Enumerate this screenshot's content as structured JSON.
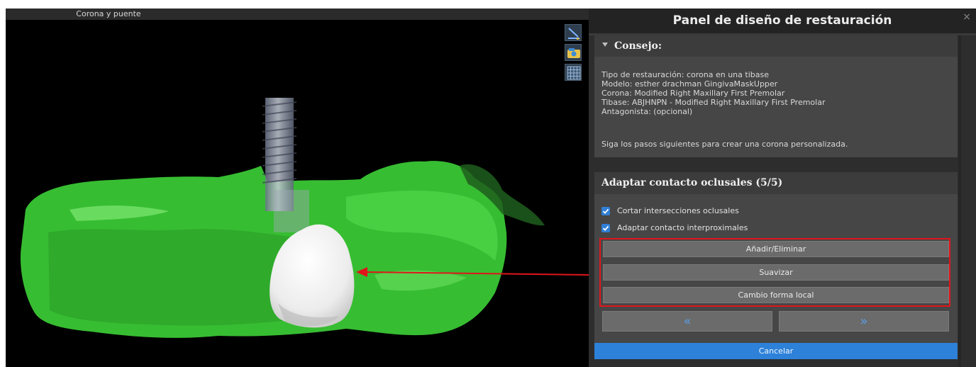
{
  "viewport": {
    "title": "Corona y puente",
    "tools": [
      "clip-plane-icon",
      "camera-icon",
      "grid-icon"
    ]
  },
  "panel": {
    "title": "Panel de diseño de restauración",
    "close_label": "×",
    "advice": {
      "header": "Consejo:",
      "lines": [
        "Tipo de restauración: corona en una tibase",
        "Modelo: esther drachman GingivaMaskUpper",
        "Corona: Modified Right Maxillary First Premolar",
        "Tibase: ABJHNPN - Modified Right Maxillary First Premolar",
        "Antagonista: (opcional)",
        "",
        "Siga los pasos siguientes para crear una corona personalizada."
      ]
    },
    "step": {
      "header": "Adaptar contacto oclusales (5/5)",
      "checkboxes": [
        {
          "label": "Cortar intersecciones oclusales",
          "checked": true
        },
        {
          "label": "Adaptar contacto interproximales",
          "checked": true
        }
      ],
      "buttons": {
        "add_remove": "Añadir/Eliminar",
        "smooth": "Suavizar",
        "local_shape": "Cambio forma local",
        "prev": "«",
        "next": "»"
      }
    },
    "cancel_label": "Cancelar"
  },
  "colors": {
    "accent": "#2d81d8",
    "highlight": "#e0151c",
    "gingiva": "#3fcf3a",
    "crown": "#f2f2f2"
  }
}
